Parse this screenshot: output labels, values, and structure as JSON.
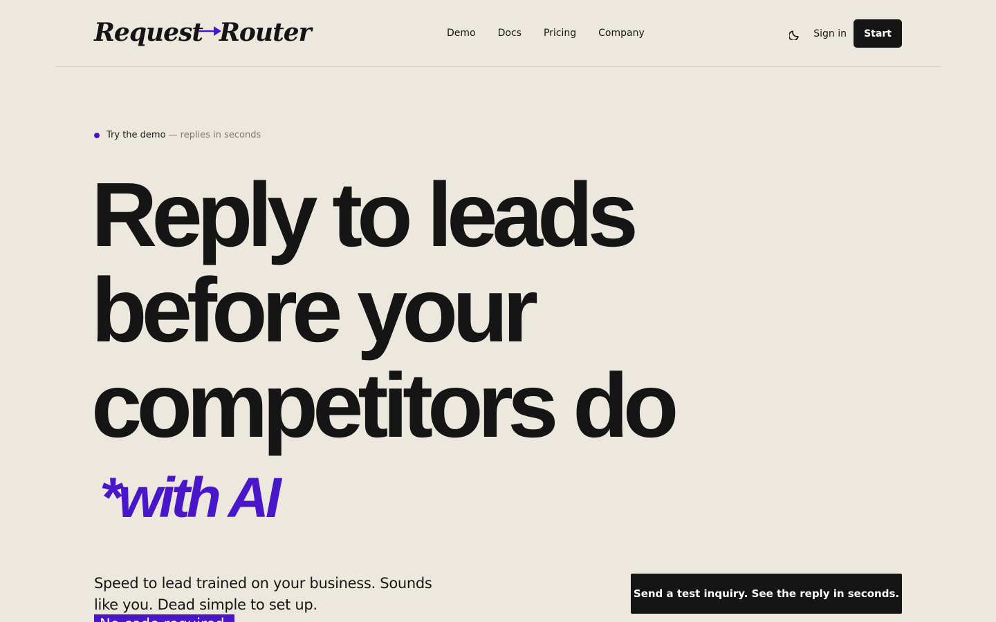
{
  "brand": {
    "logo_left": "Request",
    "logo_right": "Router",
    "accent_color": "#4a16c9",
    "icon": "arrow-right-icon"
  },
  "nav": {
    "items": [
      {
        "label": "Demo"
      },
      {
        "label": "Docs"
      },
      {
        "label": "Pricing"
      },
      {
        "label": "Company"
      }
    ]
  },
  "header": {
    "theme_icon": "moon-icon",
    "sign_in": "Sign in",
    "start": "Start"
  },
  "hero": {
    "eyebrow_primary": "Try the demo",
    "eyebrow_secondary": "— replies in seconds",
    "headline_lines": [
      "Reply to leads",
      "before your",
      "competitors do"
    ],
    "accent": "*with AI",
    "subcopy": "Speed to lead trained on your business. Sounds like you. Dead simple to set up.",
    "tag": "No code required.",
    "cta": "Send a test inquiry. See the reply in seconds."
  },
  "colors": {
    "background": "#ede8de",
    "text": "#151515",
    "accent": "#4a16c9",
    "muted": "#7b7770"
  }
}
